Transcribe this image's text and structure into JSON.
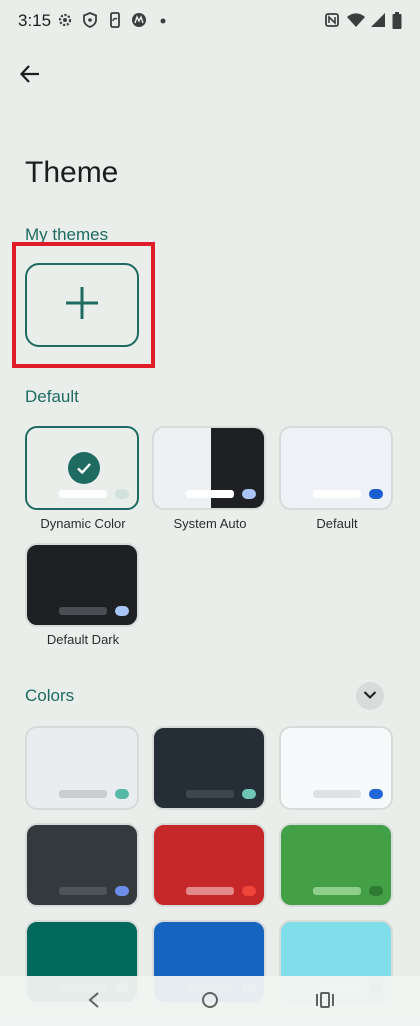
{
  "status_bar": {
    "time": "3:15",
    "left_icons": [
      "gear-icon",
      "shield-icon",
      "phone-sync-icon",
      "motorola-icon",
      "dot-icon"
    ],
    "right_icons": [
      "nfc-icon",
      "wifi-icon",
      "signal-icon",
      "battery-icon"
    ]
  },
  "header": {
    "back_icon": "arrow-back-icon",
    "title": "Theme"
  },
  "my_themes": {
    "heading": "My themes",
    "add_icon": "plus-icon"
  },
  "default_section": {
    "heading": "Default",
    "themes": [
      {
        "label": "Dynamic Color",
        "selected": true,
        "bg": "#e9eeeb",
        "border": "#1f6b62",
        "bar": "#ffffff",
        "dot": "#d2e3dd"
      },
      {
        "label": "System Auto",
        "bg": "#eef1f4",
        "dark_half": "#1f2023",
        "bar": "#ffffff",
        "dot": "#a8c4f5"
      },
      {
        "label": "Default",
        "bg": "#eef1f5",
        "bar": "#ffffff",
        "dot": "#1a5fd0"
      },
      {
        "label": "Default Dark",
        "bg": "#1f2023",
        "bar": "#4a4d52",
        "dot": "#a8c4f5"
      }
    ]
  },
  "colors_section": {
    "heading": "Colors",
    "expand_icon": "chevron-down-icon",
    "swatches": [
      {
        "bg": "#e9edef",
        "bar": "#c9cdd0",
        "dot": "#55b9a8"
      },
      {
        "bg": "#252e36",
        "bar": "#3c464f",
        "dot": "#6fc5b6"
      },
      {
        "bg": "#f7f9fa",
        "bar": "#dfe2e4",
        "dot": "#2167d8"
      },
      {
        "bg": "#34393e",
        "bar": "#4d5358",
        "dot": "#6b8de8"
      },
      {
        "bg": "#c6282a",
        "bar": "#e28a8a",
        "dot": "#f0453a"
      },
      {
        "bg": "#43a047",
        "bar": "#8fcf8c",
        "dot": "#2e7a32"
      },
      {
        "bg": "#00695c",
        "bar": "#3b8a7e",
        "dot": "#5fc0b0"
      },
      {
        "bg": "#1565c0",
        "bar": "#5a8fd6",
        "dot": "#7fb0f0"
      },
      {
        "bg": "#80deea",
        "bar": "#b8eef4",
        "dot": "#3fb6c7"
      }
    ]
  },
  "nav_bar": {
    "back_icon": "nav-back-icon",
    "home_icon": "nav-home-icon",
    "recents_icon": "nav-recents-icon"
  }
}
